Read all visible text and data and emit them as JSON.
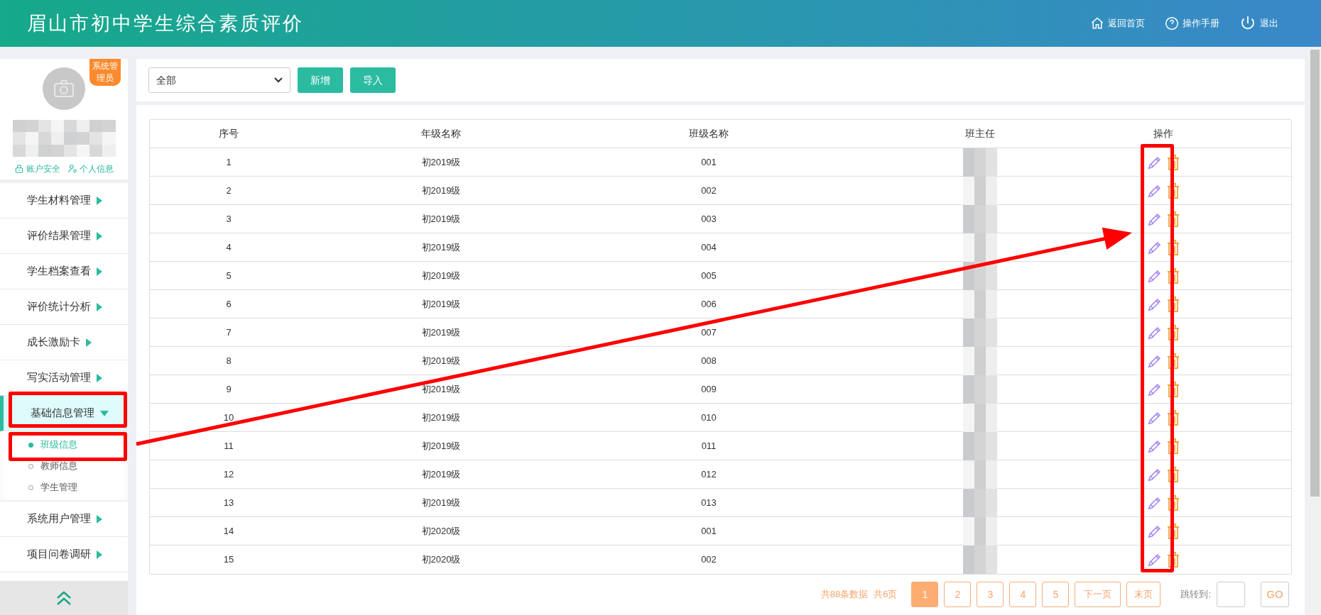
{
  "header": {
    "title": "眉山市初中学生综合素质评价",
    "links": [
      {
        "kind": "home",
        "label": "返回首页"
      },
      {
        "kind": "help",
        "label": "操作手册"
      },
      {
        "kind": "power",
        "label": "退出"
      }
    ]
  },
  "profile": {
    "badge": "系统管理员",
    "links": [
      {
        "kind": "lock",
        "label": "账户安全"
      },
      {
        "kind": "user",
        "label": "个人信息"
      }
    ]
  },
  "menu": [
    {
      "label": "学生材料管理",
      "expanded": false
    },
    {
      "label": "评价结果管理",
      "expanded": false
    },
    {
      "label": "学生档案查看",
      "expanded": false
    },
    {
      "label": "评价统计分析",
      "expanded": false
    },
    {
      "label": "成长激励卡",
      "expanded": false
    },
    {
      "label": "写实活动管理",
      "expanded": false
    },
    {
      "label": "基础信息管理",
      "expanded": true,
      "children": [
        {
          "label": "班级信息",
          "selected": true
        },
        {
          "label": "教师信息",
          "selected": false
        },
        {
          "label": "学生管理",
          "selected": false
        }
      ]
    },
    {
      "label": "系统用户管理",
      "expanded": false
    },
    {
      "label": "项目问卷调研",
      "expanded": false
    }
  ],
  "toolbar": {
    "filter": "全部",
    "buttons": [
      "新增",
      "导入"
    ]
  },
  "table": {
    "columns": [
      "序号",
      "年级名称",
      "班级名称",
      "班主任",
      "操作"
    ],
    "rows": [
      {
        "index": "1",
        "grade": "初2019级",
        "class": "001"
      },
      {
        "index": "2",
        "grade": "初2019级",
        "class": "002"
      },
      {
        "index": "3",
        "grade": "初2019级",
        "class": "003"
      },
      {
        "index": "4",
        "grade": "初2019级",
        "class": "004"
      },
      {
        "index": "5",
        "grade": "初2019级",
        "class": "005"
      },
      {
        "index": "6",
        "grade": "初2019级",
        "class": "006"
      },
      {
        "index": "7",
        "grade": "初2019级",
        "class": "007"
      },
      {
        "index": "8",
        "grade": "初2019级",
        "class": "008"
      },
      {
        "index": "9",
        "grade": "初2019级",
        "class": "009"
      },
      {
        "index": "10",
        "grade": "初2019级",
        "class": "010"
      },
      {
        "index": "11",
        "grade": "初2019级",
        "class": "011"
      },
      {
        "index": "12",
        "grade": "初2019级",
        "class": "012"
      },
      {
        "index": "13",
        "grade": "初2019级",
        "class": "013"
      },
      {
        "index": "14",
        "grade": "初2020级",
        "class": "001"
      },
      {
        "index": "15",
        "grade": "初2020级",
        "class": "002"
      }
    ]
  },
  "pagination": {
    "total": "共88条数据",
    "pages_total": "共6页",
    "pages": [
      {
        "label": "1",
        "selected": true
      },
      {
        "label": "2",
        "selected": false
      },
      {
        "label": "3",
        "selected": false
      },
      {
        "label": "4",
        "selected": false
      },
      {
        "label": "5",
        "selected": false
      }
    ],
    "next": "下一页",
    "last": "末页",
    "jump_label": "跳转到:",
    "go": "GO"
  }
}
